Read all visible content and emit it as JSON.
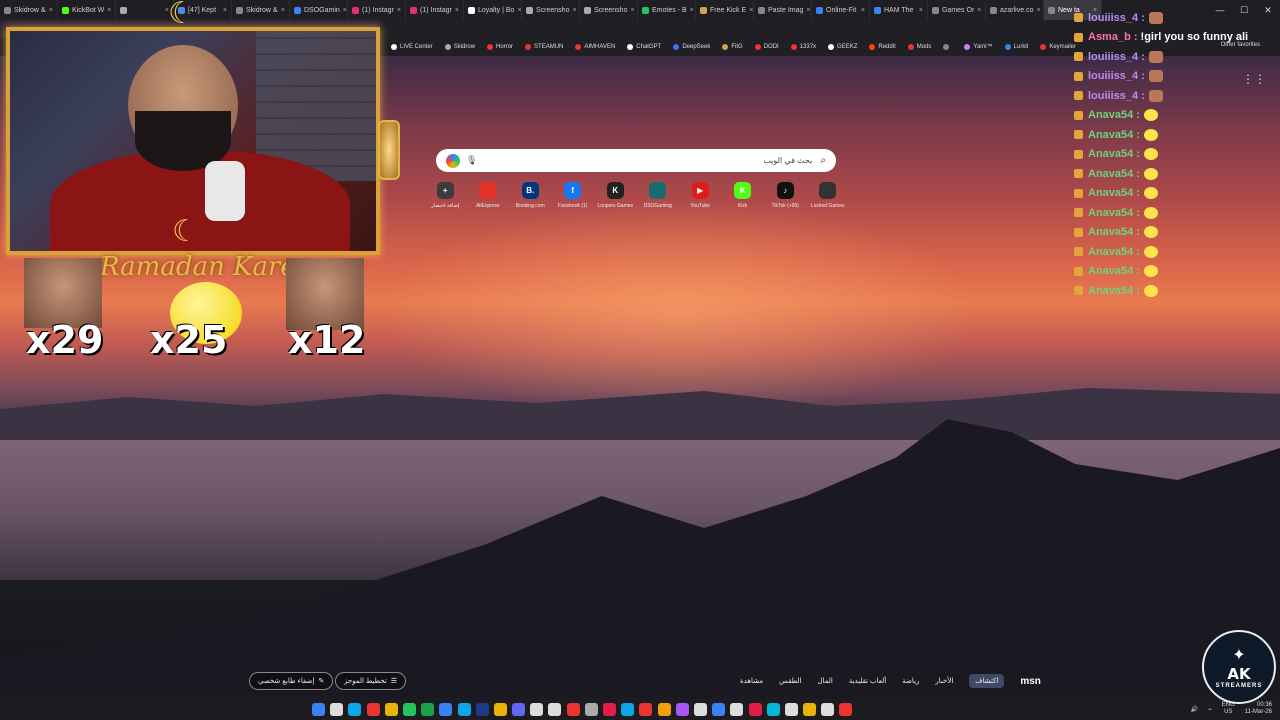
{
  "tabs": [
    {
      "label": "Skidrow & ",
      "color": "#888"
    },
    {
      "label": "KickBot W",
      "color": "#53fc18"
    },
    {
      "label": "",
      "color": "#aaa"
    },
    {
      "label": "[47] Kept",
      "color": "#4a90e2"
    },
    {
      "label": "Skidrow &",
      "color": "#888"
    },
    {
      "label": "DSOGamin",
      "color": "#3b82f6"
    },
    {
      "label": "(1) Instagr",
      "color": "#e1306c"
    },
    {
      "label": "(1) Instagr",
      "color": "#e1306c"
    },
    {
      "label": "Loyalty | Bo",
      "color": "#fff"
    },
    {
      "label": "Screensho",
      "color": "#aaa"
    },
    {
      "label": "Screensho",
      "color": "#aaa"
    },
    {
      "label": "Emotes - B",
      "color": "#22c55e"
    },
    {
      "label": "Free Kick E",
      "color": "#d1a34a"
    },
    {
      "label": "Paste Imag",
      "color": "#888"
    },
    {
      "label": "Online-Fit",
      "color": "#3b82f6"
    },
    {
      "label": "HAM The",
      "color": "#3b82f6"
    },
    {
      "label": "Games Or",
      "color": "#888"
    },
    {
      "label": "azarlive.co",
      "color": "#888"
    },
    {
      "label": "New ta",
      "color": "#888"
    }
  ],
  "bookmarks": [
    {
      "label": "LIVE Center",
      "color": "#fff"
    },
    {
      "label": "Skidrow",
      "color": "#aaa"
    },
    {
      "label": "Horror",
      "color": "#e33"
    },
    {
      "label": "STEAMUN",
      "color": "#e33"
    },
    {
      "label": "AIMHAVEN",
      "color": "#e33"
    },
    {
      "label": "ChatGPT",
      "color": "#fff"
    },
    {
      "label": "DeepSeek",
      "color": "#4a6cf7"
    },
    {
      "label": "FitG",
      "color": "#d1a34a"
    },
    {
      "label": "DODI",
      "color": "#e33"
    },
    {
      "label": "1337x",
      "color": "#e33"
    },
    {
      "label": "GEEKZ",
      "color": "#fff"
    },
    {
      "label": "Reddit",
      "color": "#ff4500"
    },
    {
      "label": "Mods",
      "color": "#e33"
    },
    {
      "label": "",
      "color": "#888"
    },
    {
      "label": "Yami™",
      "color": "#c77dff"
    },
    {
      "label": "Lurkit",
      "color": "#3b82f6"
    },
    {
      "label": "Keymailer",
      "color": "#e33"
    }
  ],
  "other_favorites": "Other favorites",
  "search": {
    "placeholder": "بحث في الويب"
  },
  "tiles": [
    {
      "label": "إضافة اختصار",
      "glyph": "+",
      "color": "#3a3a3f"
    },
    {
      "label": "AliExpress",
      "glyph": "",
      "color": "#e43225"
    },
    {
      "label": "Booking.com",
      "glyph": "B.",
      "color": "#003580"
    },
    {
      "label": "Facebook (1)",
      "glyph": "f",
      "color": "#1877f2"
    },
    {
      "label": "Loopers Games",
      "glyph": "K",
      "color": "#222"
    },
    {
      "label": "DSOGaming",
      "glyph": "",
      "color": "#1a6b6b"
    },
    {
      "label": "YouTube",
      "glyph": "▶",
      "color": "#e01b1b"
    },
    {
      "label": "Kick",
      "glyph": "K",
      "color": "#53fc18"
    },
    {
      "label": "TikTok (+99)",
      "glyph": "♪",
      "color": "#111"
    },
    {
      "label": "Locked Games",
      "glyph": "",
      "color": "#333"
    }
  ],
  "overlay": {
    "banner": "Ramadan Kareem",
    "counters": [
      "x29",
      "x25",
      "x12"
    ]
  },
  "chat": [
    {
      "user": "louiiiss_4 :",
      "msg": "",
      "style": "a",
      "emote": "face"
    },
    {
      "user": "Asma_b :",
      "msg": "!girl you so funny ali",
      "style": "b",
      "emote": ""
    },
    {
      "user": "louiiiss_4 :",
      "msg": "",
      "style": "a",
      "emote": "face"
    },
    {
      "user": "louiiiss_4 :",
      "msg": "",
      "style": "a",
      "emote": "face"
    },
    {
      "user": "louiiiss_4 :",
      "msg": "",
      "style": "a",
      "emote": "face"
    },
    {
      "user": "Anava54 :",
      "msg": "",
      "style": "c",
      "emote": "yellow"
    },
    {
      "user": "Anava54 :",
      "msg": "",
      "style": "c",
      "emote": "yellow"
    },
    {
      "user": "Anava54 :",
      "msg": "",
      "style": "c",
      "emote": "yellow"
    },
    {
      "user": "Anava54 :",
      "msg": "",
      "style": "c",
      "emote": "yellow"
    },
    {
      "user": "Anava54 :",
      "msg": "",
      "style": "c",
      "emote": "yellow"
    },
    {
      "user": "Anava54 :",
      "msg": "",
      "style": "c",
      "emote": "yellow"
    },
    {
      "user": "Anava54 :",
      "msg": "",
      "style": "c",
      "emote": "yellow"
    },
    {
      "user": "Anava54 :",
      "msg": "",
      "style": "c",
      "emote": "yellow"
    },
    {
      "user": "Anava54 :",
      "msg": "",
      "style": "c",
      "emote": "yellow"
    },
    {
      "user": "Anava54 :",
      "msg": "",
      "style": "c",
      "emote": "yellow"
    }
  ],
  "msn": {
    "logo": "msn",
    "items": [
      "اكتشاف",
      "الأخبار",
      "رياضة",
      "ألعاب تقليدية",
      "المال",
      "الطقس",
      "مشاهدة"
    ],
    "layout_btn": "تخطيط الموجز",
    "personalize_btn": "إضفاء طابع شخصي"
  },
  "taskbar": {
    "icon_colors": [
      "#3b82f6",
      "#ddd",
      "#0ea5e9",
      "#e33",
      "#eab308",
      "#22c55e",
      "#16a34a",
      "#3b82f6",
      "#0ea5e9",
      "#1e3a8a",
      "#eab308",
      "#6366f1",
      "#ddd",
      "#ddd",
      "#e33",
      "#aaa",
      "#e11d48",
      "#0ea5e9",
      "#e33",
      "#f59e0b",
      "#a855f7",
      "#ddd",
      "#3b82f6",
      "#ddd",
      "#e11d48",
      "#06b6d4",
      "#ddd",
      "#eab308",
      "#ddd",
      "#e33"
    ],
    "lang": "ENG",
    "region": "US",
    "time": "00:36",
    "date": "11-Mar-26"
  },
  "ak_logo": {
    "big": "AK",
    "small": "STREAMERS"
  }
}
